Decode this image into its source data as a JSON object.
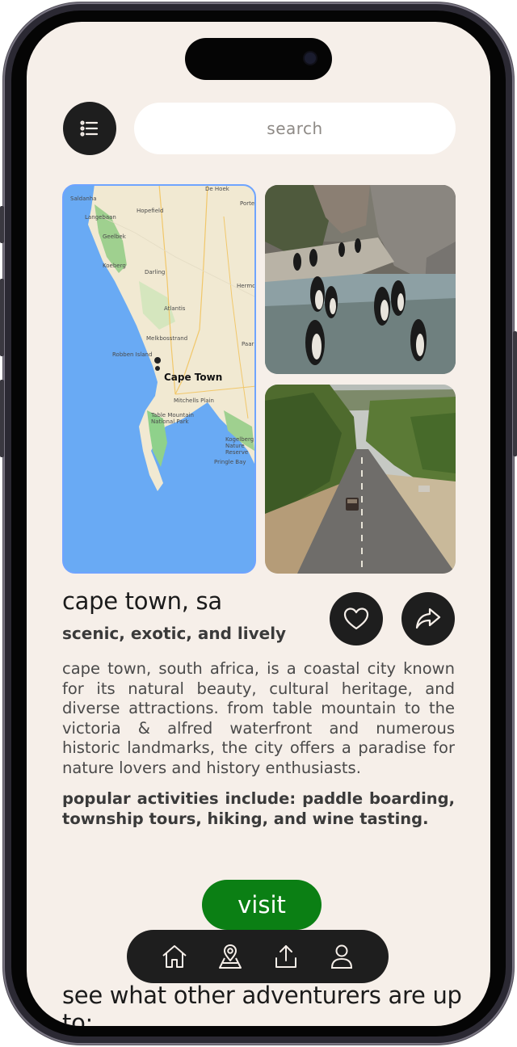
{
  "search": {
    "placeholder": "search"
  },
  "destination": {
    "title": "cape town, sa",
    "subtitle": "scenic, exotic, and lively",
    "description": "cape town, south africa, is a coastal city known for its natural beauty, cultural heritage, and diverse attractions. from table mountain to the victoria & alfred waterfront and numerous historic landmarks, the city offers a paradise for nature lovers and history enthusiasts.",
    "popular": "popular activities include: paddle boarding, township tours, hiking, and wine tasting."
  },
  "map": {
    "labels": [
      "Saldanha",
      "Hopefield",
      "Langebaan",
      "Geelbek",
      "Koeberg",
      "Darling",
      "Atlantis",
      "Melkbosstrand",
      "Robben Island",
      "Cape Town",
      "Mitchells Plain",
      "Table Mountain National Park",
      "Kogelberg Nature Reserve",
      "Pringle Bay",
      "De Hoek",
      "Porterville",
      "Hermon",
      "Paarl"
    ],
    "pin_label": "Cape Town"
  },
  "actions": {
    "visit_label": "visit"
  },
  "nav": {
    "items": [
      "home-icon",
      "map-pin-icon",
      "share-upload-icon",
      "profile-icon"
    ]
  },
  "feed": {
    "heading": "see what other adventurers are up to:"
  },
  "icons": {
    "menu": "list-menu-icon",
    "like": "heart-icon",
    "share": "share-arrow-icon"
  },
  "colors": {
    "accent_green": "#0b7f14",
    "background": "#f6efe9",
    "dark": "#1e1e1e"
  }
}
